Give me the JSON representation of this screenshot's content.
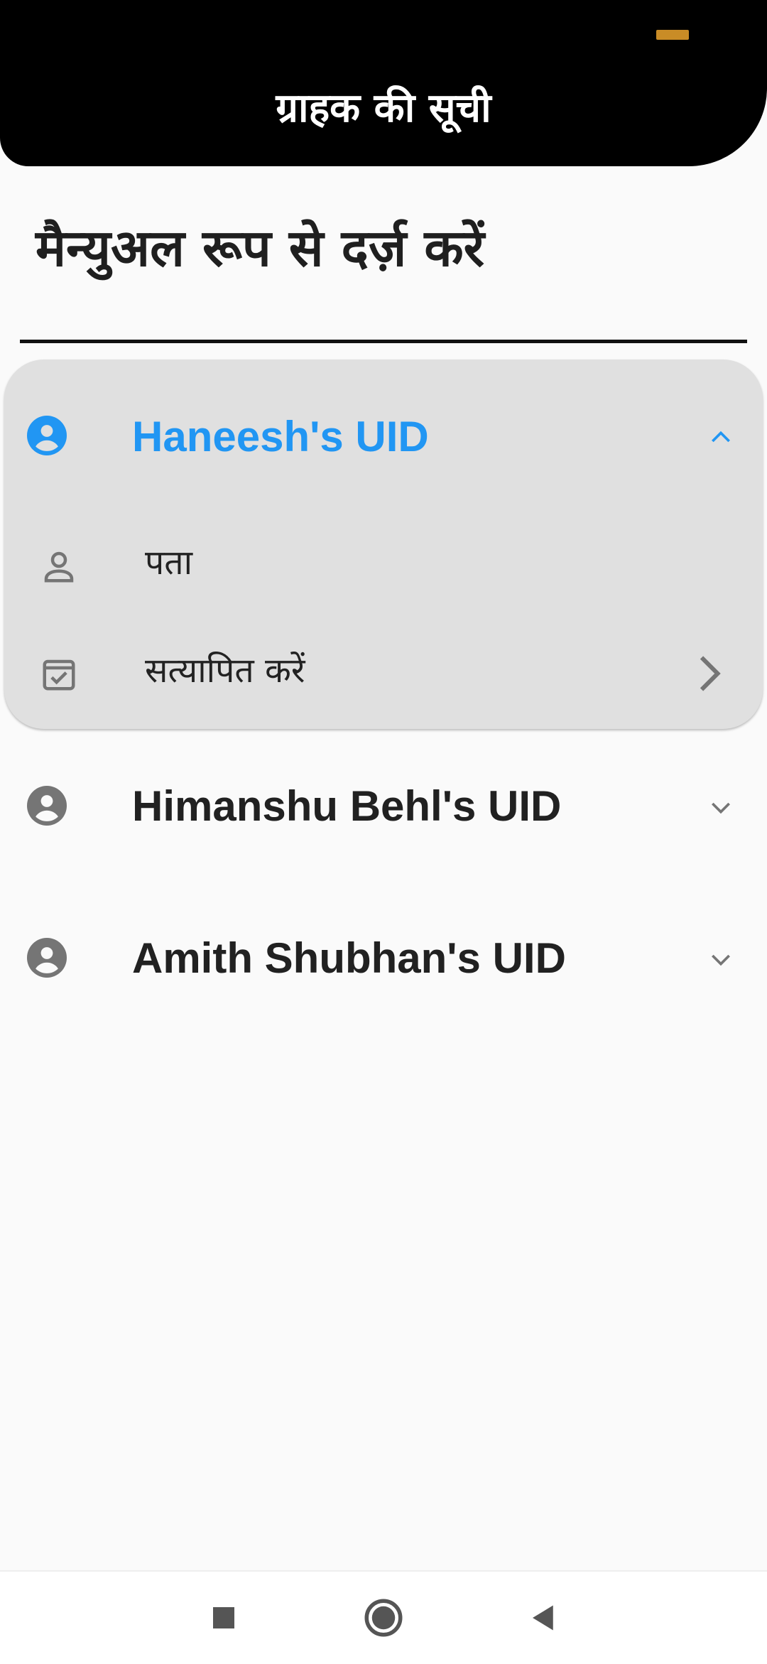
{
  "header": {
    "title": "ग्राहक की सूची",
    "indicator_color": "#c98c26"
  },
  "section": {
    "title": "मैन्युअल रूप से दर्ज़ करें"
  },
  "customers": [
    {
      "name": "Haneesh's UID",
      "expanded": true,
      "sub_items": [
        {
          "label": "पता",
          "icon": "person-outline-icon"
        },
        {
          "label": "सत्यापित करें",
          "icon": "checkbox-icon",
          "has_arrow": true
        }
      ]
    },
    {
      "name": "Himanshu Behl's UID",
      "expanded": false
    },
    {
      "name": "Amith Shubhan's UID",
      "expanded": false
    }
  ],
  "colors": {
    "accent": "#2196f3",
    "icon_gray": "#757575",
    "text_dark": "#212121",
    "card_bg": "#e0e0e0",
    "header_bg": "#000000"
  },
  "navbar": {
    "buttons": [
      "recent-apps",
      "home",
      "back"
    ]
  }
}
